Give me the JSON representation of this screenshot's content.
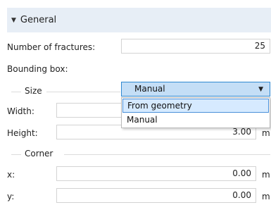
{
  "section": {
    "title": "General"
  },
  "number_of_fractures": {
    "label": "Number of fractures:",
    "value": "25"
  },
  "bounding_box": {
    "label": "Bounding box:",
    "selected": "Manual",
    "options": [
      "From geometry",
      "Manual"
    ]
  },
  "size_group": {
    "title": "Size",
    "width": {
      "label": "Width:",
      "value": "3.00",
      "unit": "m"
    },
    "height": {
      "label": "Height:",
      "value": "3.00",
      "unit": "m"
    }
  },
  "corner_group": {
    "title": "Corner",
    "x": {
      "label": "x:",
      "value": "0.00",
      "unit": "m"
    },
    "y": {
      "label": "y:",
      "value": "0.00",
      "unit": "m"
    }
  }
}
